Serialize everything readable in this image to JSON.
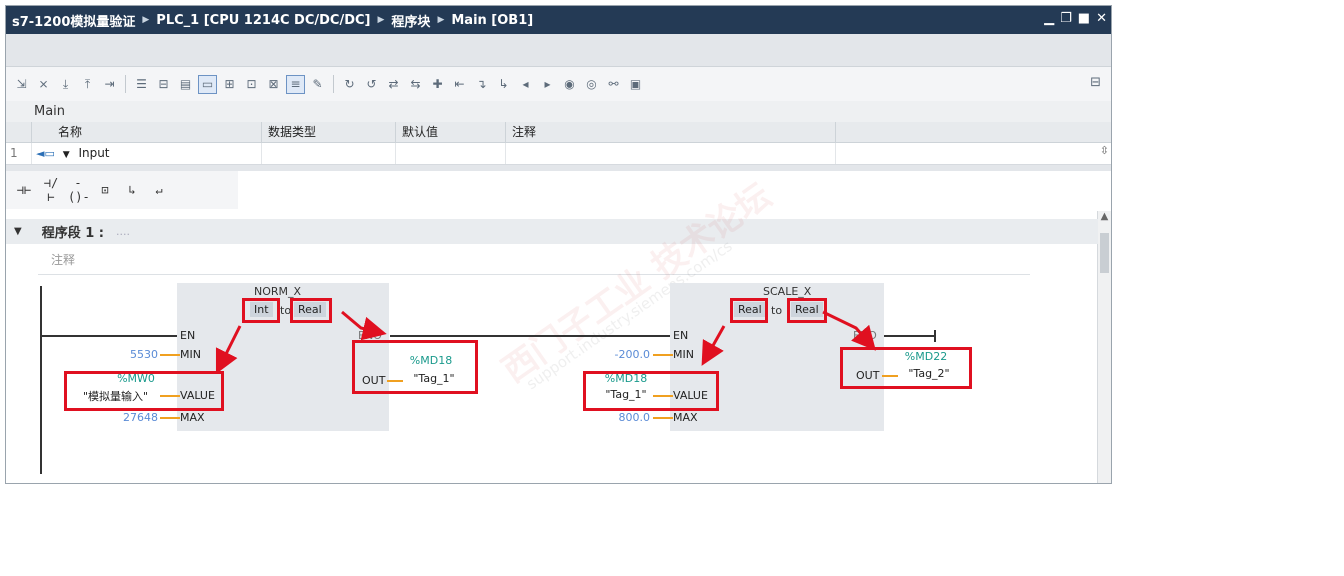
{
  "title": {
    "project": "s7-1200模拟量验证",
    "device": "PLC_1 [CPU 1214C DC/DC/DC]",
    "folder": "程序块",
    "block": "Main [OB1]"
  },
  "interface": {
    "block_name": "Main",
    "columns": [
      "名称",
      "数据类型",
      "默认值",
      "注释"
    ],
    "rows": [
      {
        "index": "1",
        "name": "Input"
      }
    ]
  },
  "network": {
    "title": "程序段 1 :",
    "placeholder": "....",
    "comment": "注释"
  },
  "instructions": {
    "norm": {
      "name": "NORM_X",
      "in_type": "Int",
      "to": "to",
      "out_type": "Real",
      "pins": {
        "en": "EN",
        "eno": "ENO",
        "min": "MIN",
        "value": "VALUE",
        "max": "MAX",
        "out": "OUT"
      },
      "min": "5530",
      "value_addr": "%MW0",
      "value_tag": "\"模拟量输入\"",
      "max": "27648",
      "out_addr": "%MD18",
      "out_tag": "\"Tag_1\""
    },
    "scale": {
      "name": "SCALE_X",
      "in_type": "Real",
      "to": "to",
      "out_type": "Real",
      "pins": {
        "en": "EN",
        "eno": "ENO",
        "min": "MIN",
        "value": "VALUE",
        "max": "MAX",
        "out": "OUT"
      },
      "min": "-200.0",
      "value_addr": "%MD18",
      "value_tag": "\"Tag_1\"",
      "max": "800.0",
      "out_addr": "%MD22",
      "out_tag": "\"Tag_2\""
    }
  },
  "watermark": {
    "text_cn": "西门子工业 技术论坛",
    "text_url": "support.industry.siemens.com/cs"
  },
  "colors": {
    "title_bar": "#243a55",
    "highlight": "#e01020",
    "address": "#1a9a8c",
    "constant": "#5a8bd6",
    "pin_wire": "#f0a020"
  }
}
